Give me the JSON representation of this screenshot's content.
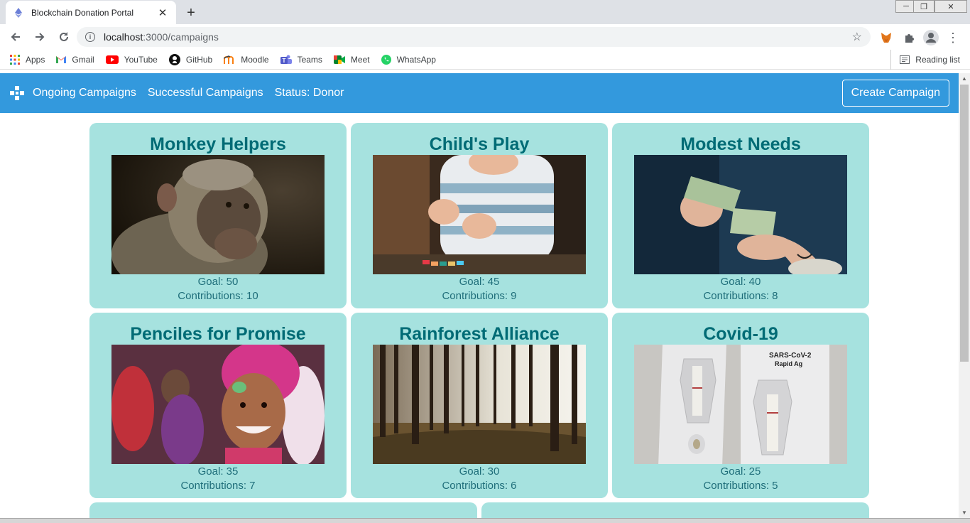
{
  "browser": {
    "tab_title": "Blockchain Donation Portal",
    "tab_close": "✕",
    "new_tab": "+",
    "url_host": "localhost",
    "url_rest": ":3000/campaigns",
    "window_buttons": [
      "─",
      "❐",
      "✕"
    ]
  },
  "bookmarks": {
    "items": [
      {
        "label": "Apps",
        "icon": "apps-grid-icon"
      },
      {
        "label": "Gmail",
        "icon": "gmail-icon"
      },
      {
        "label": "YouTube",
        "icon": "youtube-icon"
      },
      {
        "label": "GitHub",
        "icon": "github-icon"
      },
      {
        "label": "Moodle",
        "icon": "moodle-icon"
      },
      {
        "label": "Teams",
        "icon": "teams-icon"
      },
      {
        "label": "Meet",
        "icon": "meet-icon"
      },
      {
        "label": "WhatsApp",
        "icon": "whatsapp-icon"
      }
    ],
    "reading_list": "Reading list"
  },
  "navbar": {
    "links": [
      "Ongoing Campaigns",
      "Successful Campaigns",
      "Status: Donor"
    ],
    "create_button": "Create Campaign",
    "color": "#3399dd"
  },
  "campaigns": [
    {
      "title": "Monkey Helpers",
      "goal": "Goal: 50",
      "contributions": "Contributions: 10",
      "image": "monkey"
    },
    {
      "title": "Child's Play",
      "goal": "Goal: 45",
      "contributions": "Contributions: 9",
      "image": "child-toys"
    },
    {
      "title": "Modest Needs",
      "goal": "Goal: 40",
      "contributions": "Contributions: 8",
      "image": "money-hands"
    },
    {
      "title": "Penciles for Promise",
      "goal": "Goal: 35",
      "contributions": "Contributions: 7",
      "image": "smiling-girl"
    },
    {
      "title": "Rainforest Alliance",
      "goal": "Goal: 30",
      "contributions": "Contributions: 6",
      "image": "forest"
    },
    {
      "title": "Covid-19",
      "goal": "Goal: 25",
      "contributions": "Contributions: 5",
      "image": "covid-test"
    }
  ],
  "covid_test_text": [
    "SARS-CoV-2",
    "Rapid Ag"
  ],
  "colors": {
    "card": "#a6e2df",
    "title": "#006b75"
  }
}
